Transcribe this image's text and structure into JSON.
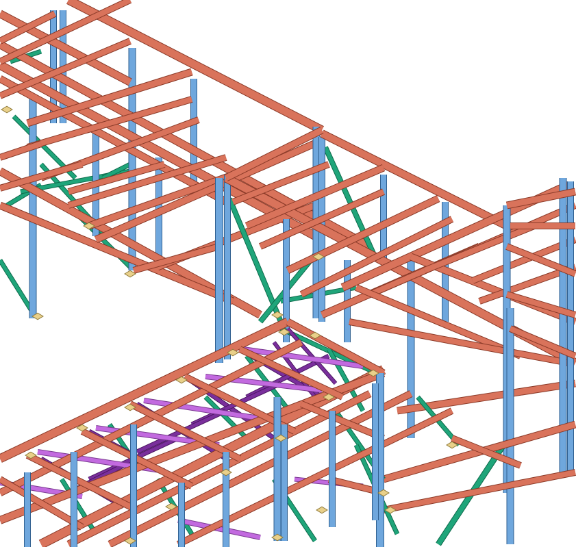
{
  "viewport": {
    "background": "#ffffff",
    "colors": {
      "beam": "#d9735b",
      "beam_edge": "#8a3a28",
      "column": "#6fa7dd",
      "column_edge": "#2f5f8f",
      "brace_green": "#1fa57a",
      "brace_green_edge": "#0e6a4b",
      "brace_purple": "#7a2f9c",
      "brace_purple_light": "#c26adf",
      "plate": "#e9d08a",
      "plate_edge": "#8f7a3a"
    },
    "model": {
      "description_visible": "",
      "elements": [
        "beam",
        "column",
        "brace",
        "gusset-plate"
      ]
    }
  }
}
